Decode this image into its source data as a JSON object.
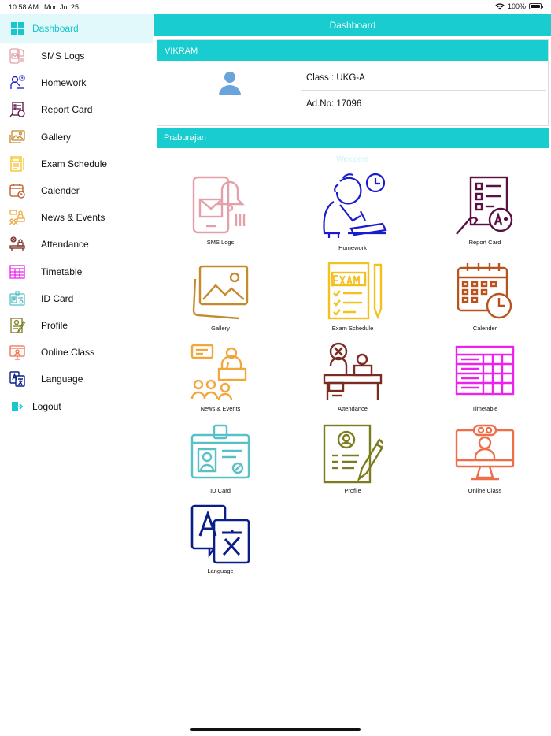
{
  "status": {
    "time": "10:58 AM",
    "date": "Mon Jul 25",
    "battery": "100%",
    "battery_level": 1.0
  },
  "sidebar": {
    "items": [
      {
        "label": "Dashboard",
        "icon": "dashboard-grid-icon"
      },
      {
        "label": "SMS Logs",
        "icon": "sms-phone-icon"
      },
      {
        "label": "Homework",
        "icon": "homework-student-icon"
      },
      {
        "label": "Report Card",
        "icon": "report-card-icon"
      },
      {
        "label": "Gallery",
        "icon": "gallery-image-icon"
      },
      {
        "label": "Exam Schedule",
        "icon": "exam-paper-icon"
      },
      {
        "label": "Calender",
        "icon": "calendar-clock-icon"
      },
      {
        "label": "News & Events",
        "icon": "news-events-icon"
      },
      {
        "label": "Attendance",
        "icon": "attendance-desk-icon"
      },
      {
        "label": "Timetable",
        "icon": "timetable-grid-icon"
      },
      {
        "label": "ID Card",
        "icon": "id-card-icon"
      },
      {
        "label": "Profile",
        "icon": "profile-document-icon"
      },
      {
        "label": "Online Class",
        "icon": "online-class-monitor-icon"
      },
      {
        "label": "Language",
        "icon": "language-translate-icon"
      },
      {
        "label": "Logout",
        "icon": "logout-arrow-icon"
      }
    ]
  },
  "header": {
    "title": "Dashboard"
  },
  "student": {
    "name": "VIKRAM",
    "class_text": "Class : UKG-A",
    "adno_text": "Ad.No: 17096"
  },
  "section": {
    "name": "Praburajan",
    "welcome": "Welcome"
  },
  "tiles": [
    {
      "label": "SMS Logs"
    },
    {
      "label": "Homework"
    },
    {
      "label": "Report Card"
    },
    {
      "label": "Gallery"
    },
    {
      "label": "Exam Schedule"
    },
    {
      "label": "Calender"
    },
    {
      "label": "News & Events"
    },
    {
      "label": "Attendance"
    },
    {
      "label": "Timetable"
    },
    {
      "label": "ID Card"
    },
    {
      "label": "Profile"
    },
    {
      "label": "Online Class"
    },
    {
      "label": "Language"
    }
  ],
  "colors": {
    "accent": "#18cccf",
    "active_bg": "#e2f9fb",
    "sms": "#e3a0a8",
    "homework": "#1a1ad0",
    "report": "#5a1140",
    "gallery": "#c58a2e",
    "exam": "#f4c11c",
    "calendar": "#b9531e",
    "news": "#f1a73c",
    "attendance": "#7a2b22",
    "timetable": "#ee22ee",
    "idcard": "#57c1c6",
    "profile": "#7c7c1e",
    "online": "#ef6e4a",
    "language": "#0a1e8a"
  }
}
